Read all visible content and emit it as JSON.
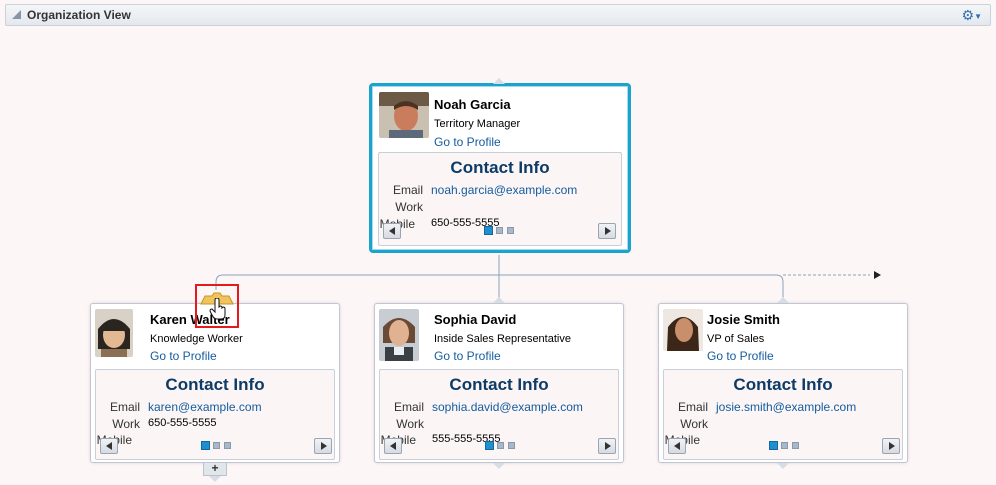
{
  "header": {
    "title": "Organization View",
    "settings_icon": "gear-icon"
  },
  "manager": {
    "name": "Noah Garcia",
    "role": "Territory Manager",
    "link": "Go to Profile",
    "contact": {
      "title": "Contact Info",
      "email_label": "Email",
      "email": "noah.garcia@example.com",
      "work_label": "Work",
      "work": "",
      "mobile_label": "Mobile",
      "mobile": "650-555-5555"
    }
  },
  "reports": [
    {
      "name": "Karen Walter",
      "role": "Knowledge Worker",
      "link": "Go to Profile",
      "contact": {
        "title": "Contact Info",
        "email_label": "Email",
        "email": "karen@example.com",
        "work_label": "Work",
        "work": "650-555-5555",
        "mobile_label": "Mobile",
        "mobile": ""
      }
    },
    {
      "name": "Sophia David",
      "role": "Inside Sales Representative",
      "link": "Go to Profile",
      "contact": {
        "title": "Contact Info",
        "email_label": "Email",
        "email": "sophia.david@example.com",
        "work_label": "Work",
        "work": "",
        "mobile_label": "Mobile",
        "mobile": "555-555-5555"
      }
    },
    {
      "name": "Josie Smith",
      "role": "VP of Sales",
      "link": "Go to Profile",
      "contact": {
        "title": "Contact Info",
        "email_label": "Email",
        "email": "josie.smith@example.com",
        "work_label": "Work",
        "work": "",
        "mobile_label": "Mobile",
        "mobile": ""
      }
    }
  ],
  "expand_label": "+",
  "colors": {
    "accent": "#1aa3cc",
    "link": "#145c9e",
    "title": "#0d3b66"
  }
}
